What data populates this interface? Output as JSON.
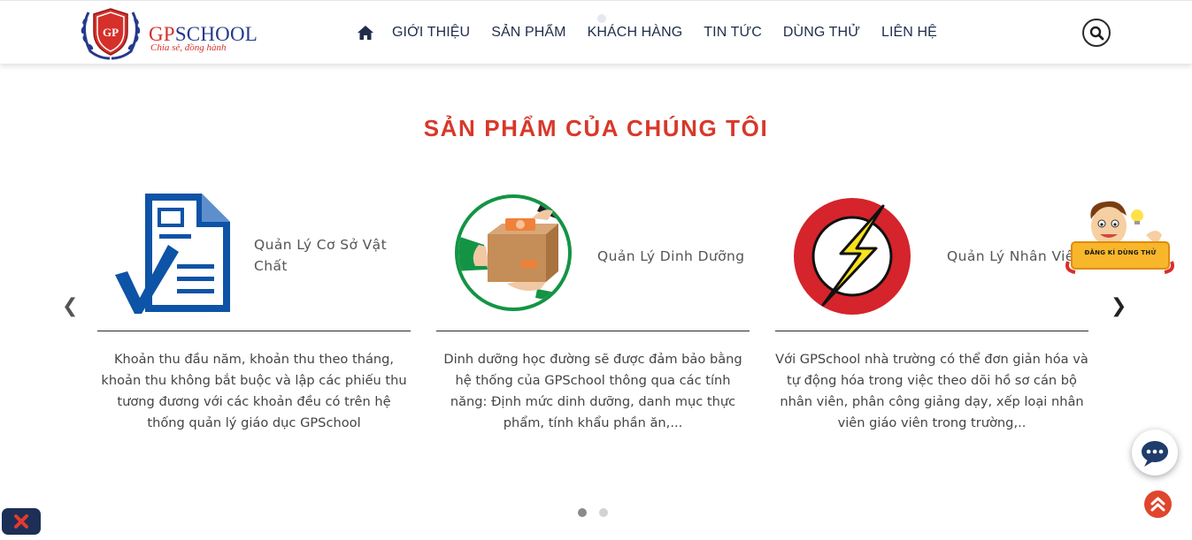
{
  "brand": {
    "name_first": "GP",
    "name_rest": "SCHOOL",
    "tagline": "Chia sẻ, đồng hành",
    "primary_color": "#243a8c",
    "accent_color": "#d6302a"
  },
  "nav": {
    "home_icon": "home-icon",
    "items": [
      "GIỚI THIỆU",
      "SẢN PHẨM",
      "KHÁCH HÀNG",
      "TIN TỨC",
      "DÙNG THỬ",
      "LIÊN HỆ"
    ],
    "search_icon": "search-icon"
  },
  "section": {
    "title": "SẢN PHẨM CỦA CHÚNG TÔI"
  },
  "carousel": {
    "prev": "❮",
    "next": "❯",
    "pages": 2,
    "active_page": 1,
    "cards": [
      {
        "icon": "document-check-icon",
        "title": "Quản Lý Cơ Sở Vật Chất",
        "description": "Khoản thu đầu năm, khoản thu theo tháng, khoản thu không bắt buộc và lập các phiếu thu tương đương với các khoản đều có trên hệ thống quản lý giáo dục GPSchool"
      },
      {
        "icon": "delivery-box-icon",
        "title": "Quản Lý Dinh Dưỡng",
        "description": "Dinh dưỡng học đường sẽ được đảm bảo bằng hệ thống của GPSchool thông qua các tính năng: Định mức dinh dưỡng, danh mục thực phẩm, tính khẩu phần ăn,..."
      },
      {
        "icon": "lightning-bolt-icon",
        "title": "Quản Lý Nhân Viên",
        "description": "Với GPSchool nhà trường có thể đơn giản hóa và tự động hóa trong việc theo dõi hồ sơ cán bộ nhân viên, phân công giảng dạy, xếp loại nhân viên giáo viên trong trường,.."
      }
    ]
  },
  "widgets": {
    "trial_label": "ĐĂNG KÍ DÙNG THỬ",
    "chat_icon": "chat-bubble-icon",
    "back_to_top_icon": "double-chevron-up-icon",
    "close_icon": "close-icon"
  }
}
